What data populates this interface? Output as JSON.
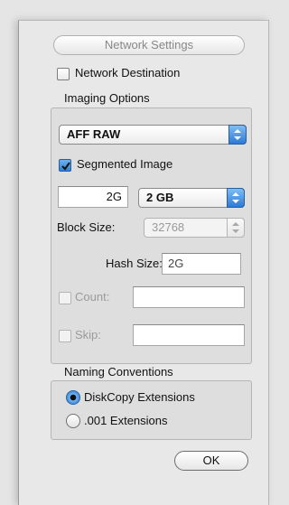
{
  "network_settings_button": "Network Settings",
  "network_destination": {
    "label": "Network Destination",
    "checked": false
  },
  "imaging_options": {
    "title": "Imaging Options",
    "format_select": "AFF RAW",
    "segmented_image": {
      "label": "Segmented Image",
      "checked": true
    },
    "segment_value": "2G",
    "segment_unit_select": "2 GB",
    "block_size_label": "Block Size:",
    "block_size_select": "32768",
    "hash_size_label": "Hash Size:",
    "hash_size_value": "2G",
    "count": {
      "label": "Count:",
      "checked": false,
      "value": ""
    },
    "skip": {
      "label": "Skip:",
      "checked": false,
      "value": ""
    }
  },
  "naming_conventions": {
    "title": "Naming Conventions",
    "options": [
      {
        "label": "DiskCopy Extensions",
        "selected": true
      },
      {
        "label": ".001 Extensions",
        "selected": false
      }
    ]
  },
  "ok_button": "OK",
  "colors": {
    "accent_blue": "#2e7fd6",
    "panel_bg": "#e8e8e8",
    "group_bg": "#dedede"
  }
}
